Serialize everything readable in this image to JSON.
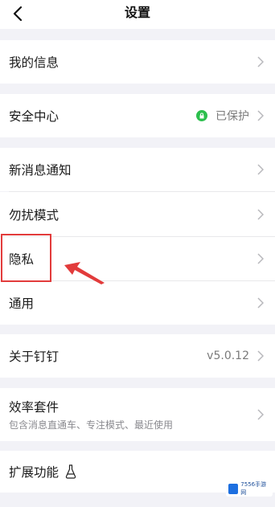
{
  "header": {
    "title": "设置"
  },
  "items": {
    "my_info": {
      "label": "我的信息"
    },
    "security": {
      "label": "安全中心",
      "status": "已保护"
    },
    "notifications": {
      "label": "新消息通知"
    },
    "dnd": {
      "label": "勿扰模式"
    },
    "privacy": {
      "label": "隐私"
    },
    "general": {
      "label": "通用"
    },
    "about": {
      "label": "关于钉钉",
      "version": "v5.0.12"
    },
    "efficiency": {
      "label": "效率套件",
      "subtitle": "包含消息直通车、专注模式、最近使用"
    },
    "extensions": {
      "label": "扩展功能"
    }
  },
  "watermark": {
    "text": "7556手游网"
  },
  "colors": {
    "background": "#f2f2f7",
    "status_green": "#2cbf4d",
    "highlight_red": "#e23b3b",
    "chevron": "#b8b8bc"
  }
}
